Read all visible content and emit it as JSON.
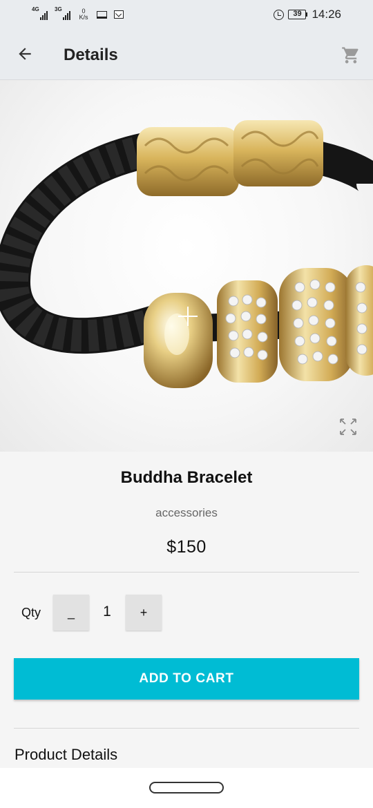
{
  "status_bar": {
    "signal1_network": "4G",
    "signal2_network": "3G",
    "speed_value": "0",
    "speed_unit": "K/s",
    "battery": "39",
    "time": "14:26",
    "icons": [
      "signal-icon",
      "signal-icon",
      "monitor-icon",
      "mail-icon",
      "alarm-icon",
      "battery-icon"
    ]
  },
  "app_bar": {
    "title": "Details",
    "back_icon": "arrow-left-icon",
    "cart_icon": "shopping-cart-icon"
  },
  "product": {
    "image_alt": "product-photo",
    "name": "Buddha Bracelet",
    "category": "accessories",
    "price": "$150"
  },
  "quantity": {
    "label": "Qty",
    "minus_label": "_",
    "value": "1",
    "plus_label": "+"
  },
  "actions": {
    "add_to_cart_label": "ADD TO CART"
  },
  "sections": {
    "details_title": "Product Details"
  },
  "colors": {
    "accent": "#00bcd4",
    "app_bar_bg": "#e9ecef",
    "page_bg": "#f5f5f5"
  }
}
